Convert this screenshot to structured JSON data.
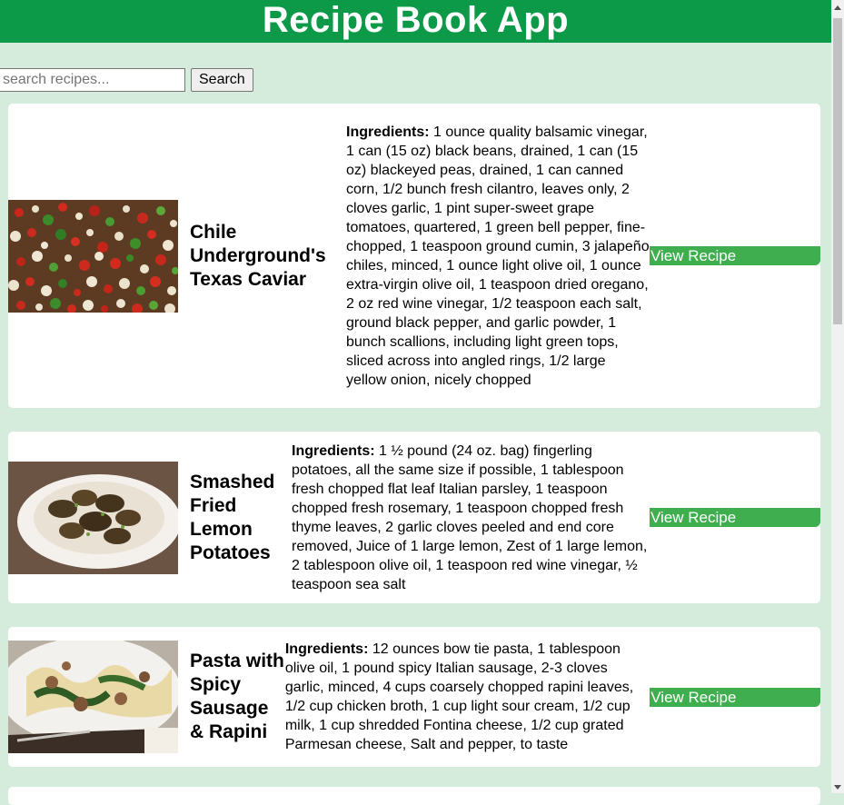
{
  "header": {
    "title": "Recipe Book App"
  },
  "search": {
    "placeholder": "search recipes...",
    "button_label": "Search"
  },
  "recipes": [
    {
      "title": "Chile Underground's Texas Caviar",
      "ingredients_label": "Ingredients:",
      "ingredients": " 1 ounce quality balsamic vinegar, 1 can (15 oz) black beans, drained, 1 can (15 oz) blackeyed peas, drained, 1 can canned corn, 1/2 bunch fresh cilantro, leaves only, 2 cloves garlic, 1 pint super-sweet grape tomatoes, quartered, 1 green bell pepper, fine-chopped, 1 teaspoon ground cumin, 3 jalapeño chiles, minced, 1 ounce light olive oil, 1 ounce extra-virgin olive oil, 1 teaspoon dried oregano, 2 oz red wine vinegar, 1/2 teaspoon each salt, ground black pepper, and garlic powder, 1 bunch scallions, including light green tops, sliced across into angled rings, 1/2 large yellow onion, nicely chopped",
      "button_label": "View Recipe"
    },
    {
      "title": "Smashed Fried Lemon Potatoes",
      "ingredients_label": "Ingredients:",
      "ingredients": " 1 ½ pound (24 oz. bag) fingerling potatoes, all the same size if possible, 1 tablespoon fresh chopped flat leaf Italian parsley, 1 teaspoon chopped fresh rosemary, 1 teaspoon chopped fresh thyme leaves, 2 garlic cloves peeled and end core removed, Juice of 1 large lemon, Zest of 1 large lemon, 2 tablespoon olive oil, 1 teaspoon red wine vinegar, ½ teaspoon sea salt",
      "button_label": "View Recipe"
    },
    {
      "title": "Pasta with Spicy Sausage & Rapini",
      "ingredients_label": "Ingredients:",
      "ingredients": " 12 ounces bow tie pasta, 1 tablespoon olive oil, 1 pound spicy Italian sausage, 2-3 cloves garlic, minced, 4 cups coarsely chopped rapini leaves, 1/2 cup chicken broth, 1 cup light sour cream, 1/2 cup milk, 1 cup shredded Fontina cheese, 1/2 cup grated Parmesan cheese, Salt and pepper, to taste",
      "button_label": "View Recipe"
    }
  ],
  "colors": {
    "header_bg": "#0d9a48",
    "page_bg": "#d5ecdc",
    "button_bg": "#3fae4e"
  }
}
